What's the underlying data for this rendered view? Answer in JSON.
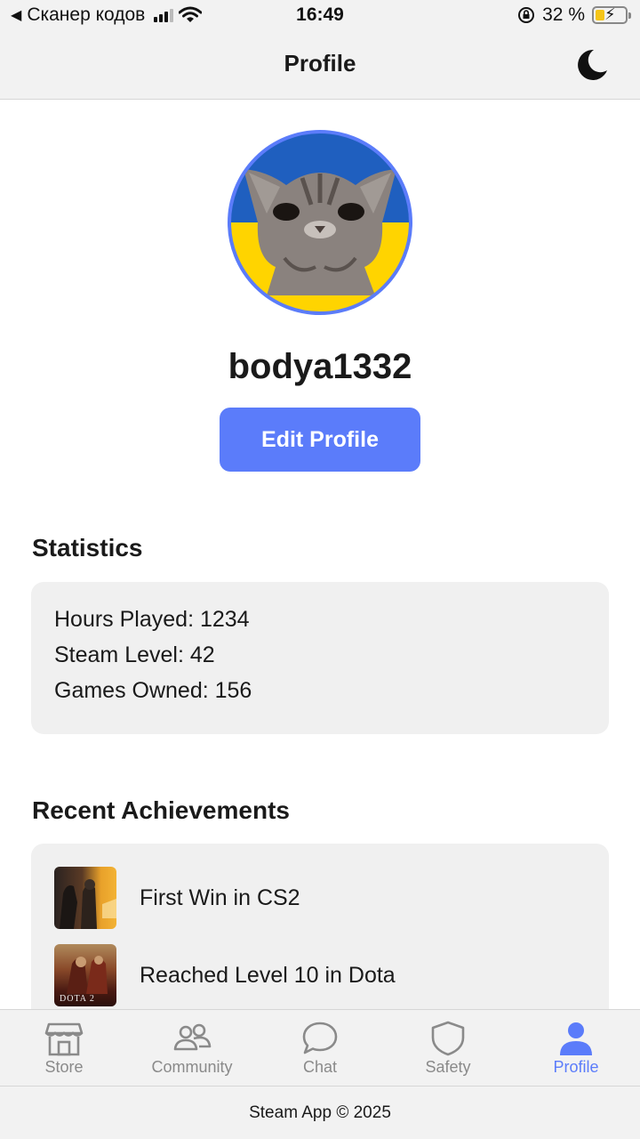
{
  "status_bar": {
    "back_label": "Сканер кодов",
    "time": "16:49",
    "battery": "32 %",
    "battery_level": 0.32
  },
  "header": {
    "title": "Profile",
    "theme_icon": "moon-icon"
  },
  "profile": {
    "avatar_icon": "cat-avatar",
    "username": "bodya1332",
    "edit_button": "Edit Profile"
  },
  "statistics": {
    "title": "Statistics",
    "lines": [
      "Hours Played: 1234",
      "Steam Level: 42",
      "Games Owned: 156"
    ]
  },
  "achievements": {
    "title": "Recent Achievements",
    "items": [
      {
        "label": "First Win in CS2",
        "icon": "cs2-thumbnail"
      },
      {
        "label": "Reached Level 10 in Dota",
        "icon": "dota2-thumbnail",
        "thumb_text": "DOTA 2"
      }
    ]
  },
  "tabs": [
    {
      "label": "Store",
      "icon": "store-icon",
      "active": false
    },
    {
      "label": "Community",
      "icon": "community-icon",
      "active": false
    },
    {
      "label": "Chat",
      "icon": "chat-icon",
      "active": false
    },
    {
      "label": "Safety",
      "icon": "shield-icon",
      "active": false
    },
    {
      "label": "Profile",
      "icon": "profile-icon",
      "active": true
    }
  ],
  "footer": {
    "text": "Steam App © 2025"
  },
  "colors": {
    "accent": "#5b7cfa",
    "inactive": "#8a8a8a",
    "bar_background": "#f2f2f2",
    "card_background": "#f0f0f0"
  }
}
